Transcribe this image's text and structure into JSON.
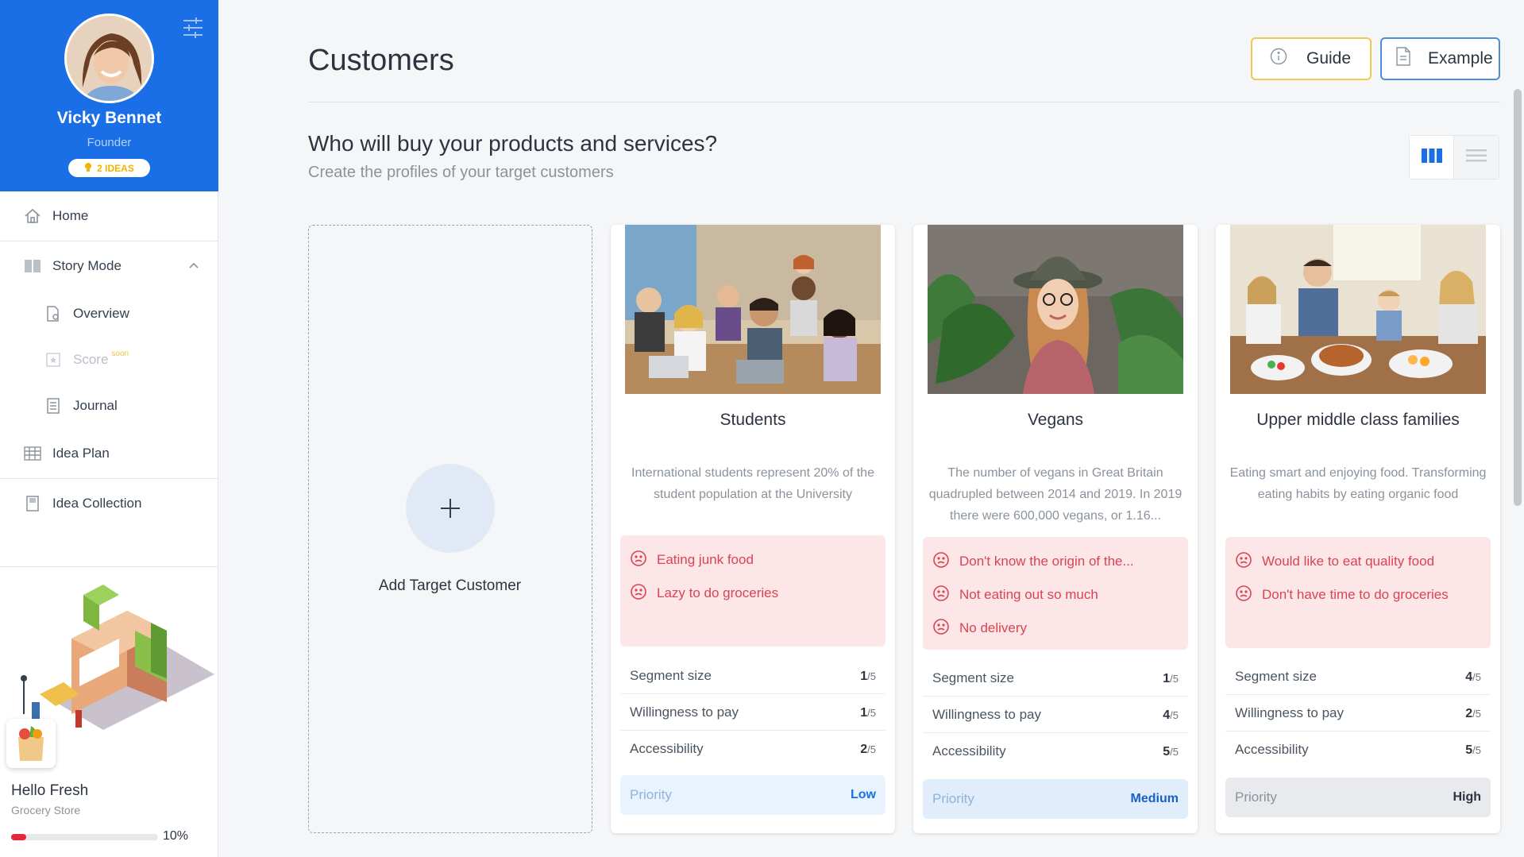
{
  "profile": {
    "name": "Vicky Bennet",
    "role": "Founder",
    "ideas_badge": "2 IDEAS"
  },
  "nav": {
    "home": "Home",
    "story_mode": "Story Mode",
    "overview": "Overview",
    "score": "Score",
    "score_soon": "soon",
    "journal": "Journal",
    "idea_plan": "Idea Plan",
    "idea_collection": "Idea Collection"
  },
  "current_idea": {
    "name": "Hello Fresh",
    "type": "Grocery Store",
    "progress_label": "10%",
    "progress": 0.1
  },
  "header": {
    "title": "Customers",
    "guide_label": "Guide",
    "example_label": "Example",
    "question": "Who will buy your products and services?",
    "subtitle": "Create the profiles of your target customers"
  },
  "add_card": {
    "label": "Add Target Customer"
  },
  "customers": [
    {
      "title": "Students",
      "description": "International students represent 20% of the student population at the University",
      "pains": [
        "Eating junk food",
        "Lazy to do groceries"
      ],
      "segment_label": "Segment size",
      "segment_value": "1",
      "willingness_label": "Willingness to pay",
      "willingness_value": "1",
      "access_label": "Accessibility",
      "access_value": "2",
      "scale": "/5",
      "priority_label": "Priority",
      "priority_level": "Low"
    },
    {
      "title": "Vegans",
      "description": "The number of vegans in Great Britain quadrupled between 2014 and 2019. In 2019 there were 600,000 vegans, or 1.16...",
      "pains": [
        "Don't know the origin of the...",
        "Not eating out so much",
        "No delivery"
      ],
      "segment_label": "Segment size",
      "segment_value": "1",
      "willingness_label": "Willingness to pay",
      "willingness_value": "4",
      "access_label": "Accessibility",
      "access_value": "5",
      "scale": "/5",
      "priority_label": "Priority",
      "priority_level": "Medium"
    },
    {
      "title": "Upper middle class families",
      "description": "Eating smart and enjoying food. Transforming eating habits by eating organic food",
      "pains": [
        "Would like to eat quality food",
        "Don't have time to do groceries"
      ],
      "segment_label": "Segment size",
      "segment_value": "4",
      "willingness_label": "Willingness to pay",
      "willingness_value": "2",
      "access_label": "Accessibility",
      "access_value": "5",
      "scale": "/5",
      "priority_label": "Priority",
      "priority_level": "High"
    }
  ],
  "colors": {
    "brand_blue": "#1a6fe6",
    "guide_border": "#f2c94c",
    "example_border": "#4a90d9",
    "pain_bg": "#fde6e7",
    "pain_text": "#d94452",
    "progress_red": "#e5283b"
  }
}
